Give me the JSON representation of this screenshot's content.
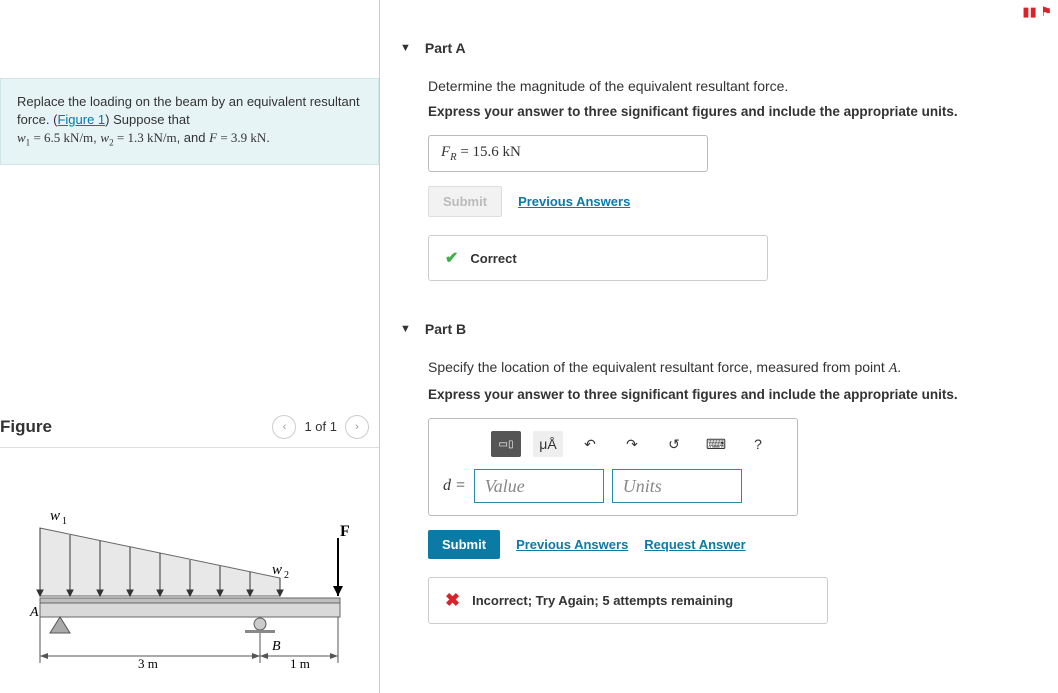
{
  "problem": {
    "intro": "Replace the loading on the beam by an equivalent resultant force. (",
    "figure_link": "Figure 1",
    "intro2": ") Suppose that",
    "w1_label": "w",
    "w1_sub": "1",
    "w1_eq": " = 6.5 kN/m",
    "w2_label": "w",
    "w2_sub": "2",
    "w2_eq": " = 1.3 kN/m",
    "and": ", and ",
    "F_label": "F",
    "F_eq": " = 3.9 kN",
    "period": "."
  },
  "figure_panel": {
    "title": "Figure",
    "counter": "1 of 1",
    "labels": {
      "w1": "w₁",
      "w2": "w₂",
      "F": "F",
      "A": "A",
      "B": "B",
      "d1": "3 m",
      "d2": "1 m"
    }
  },
  "partA": {
    "title": "Part A",
    "prompt": "Determine the magnitude of the equivalent resultant force.",
    "instruct": "Express your answer to three significant figures and include the appropriate units.",
    "answer_lhs": "F",
    "answer_sub": "R",
    "answer_eq": " =  15.6 kN",
    "submit": "Submit",
    "prev": "Previous Answers",
    "feedback": "Correct"
  },
  "partB": {
    "title": "Part B",
    "prompt_pre": "Specify the location of the equivalent resultant force, measured from point ",
    "prompt_pt": "A",
    "prompt_post": ".",
    "instruct": "Express your answer to three significant figures and include the appropriate units.",
    "lhs": "d",
    "value_ph": "Value",
    "units_ph": "Units",
    "submit": "Submit",
    "prev": "Previous Answers",
    "req": "Request Answer",
    "feedback": "Incorrect; Try Again; 5 attempts remaining",
    "tools": {
      "units": "μÅ",
      "undo": "↶",
      "redo": "↷",
      "reset": "↺",
      "keyboard": "⌨",
      "help": "?"
    }
  }
}
